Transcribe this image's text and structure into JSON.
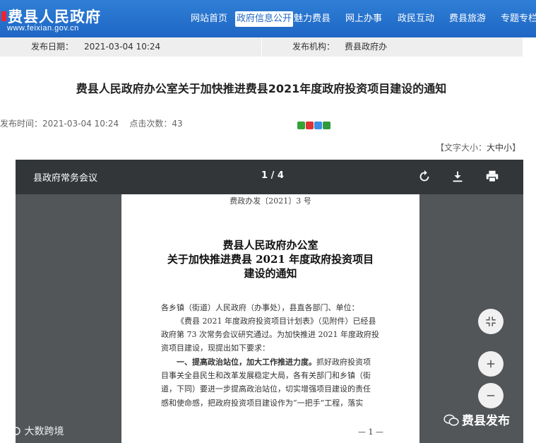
{
  "site": {
    "title": "费县人民政府",
    "url": "www.feixian.gov.cn"
  },
  "nav": {
    "items": [
      "网站首页",
      "政府信息公开",
      "魅力费县",
      "网上办事",
      "政民互动",
      "费县旅游",
      "专题专栏"
    ],
    "active_index": 1
  },
  "meta": {
    "date_label": "发布日期：",
    "date_value": "2021-03-04 10:24",
    "org_label": "发布机构：",
    "org_value": "费县政府办"
  },
  "article": {
    "title": "费县人民政府办公室关于加快推进费县2021年度政府投资项目建设的通知",
    "pub_time": "发布时间：2021-03-04 10:24",
    "clicks": "点击次数：43",
    "fontsize_open": "【文字大小：",
    "fontsize_big": "大",
    "fontsize_mid": "中",
    "fontsize_small": "小",
    "fontsize_close": "】"
  },
  "viewer": {
    "title": "县政府常务会议",
    "page_indicator": "1 / 4",
    "icons": [
      "rotate-icon",
      "download-icon",
      "print-icon"
    ]
  },
  "document": {
    "doc_no": "费政办发〔2021〕3 号",
    "title_lines": [
      "费县人民政府办公室",
      "关于加快推进费县 2021 年度政府投资项目",
      "建设的通知"
    ],
    "body_lines": [
      "各乡镇（街道）人民政府（办事处），县直各部门、单位：",
      "《费县 2021 年度政府投资项目计划表》（见附件）已经县",
      "政府第 73 次常务会议研究通过。为加快推进 2021 年度政府投",
      "资项目建设，现提出如下要求：",
      "一、提高政治站位，加大工作推进力度。",
      "抓好政府投资项",
      "目事关全县民生和改革发展稳定大局，各有关部门和乡镇（街",
      "道，下同）要进一步提高政治站位，切实增强项目建设的责任",
      "感和使命感，把政府投资项目建设作为“一把手”工程，落实"
    ],
    "page_footer": "— 1 —"
  },
  "watermarks": {
    "left": "大数跨境",
    "right": "费县发布"
  }
}
